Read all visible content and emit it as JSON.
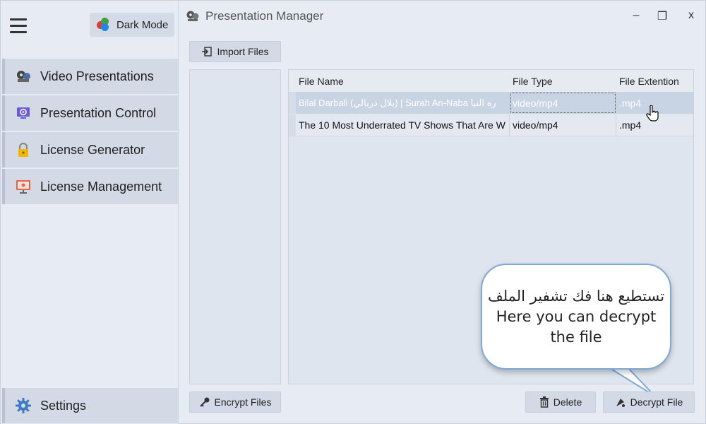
{
  "window": {
    "title": "Presentation Manager",
    "controls": {
      "minimize": "–",
      "maximize": "❐",
      "close": "x"
    }
  },
  "sidebar": {
    "dark_mode_label": "Dark Mode",
    "items": [
      {
        "label": "Video Presentations",
        "icon": "film-reel-icon"
      },
      {
        "label": "Presentation Control",
        "icon": "monitor-gear-icon"
      },
      {
        "label": "License Generator",
        "icon": "padlock-icon"
      },
      {
        "label": "License Management",
        "icon": "presentation-board-icon"
      }
    ],
    "settings_label": "Settings"
  },
  "toolbar": {
    "import_label": "Import Files",
    "encrypt_label": "Encrypt Files",
    "delete_label": "Delete",
    "decrypt_label": "Decrypt File"
  },
  "table": {
    "headers": [
      "File Name",
      "File Type",
      "File Extention"
    ],
    "rows": [
      {
        "name": "Bilal Darbali (بلال دربالي) | Surah An-Naba  ره النبا",
        "type": "video/mp4",
        "ext": ".mp4",
        "selected": true
      },
      {
        "name": "The 10 Most Underrated TV Shows That Are W",
        "type": "video/mp4",
        "ext": ".mp4",
        "selected": false
      }
    ]
  },
  "callout": {
    "line_ar": "تستطيع هنا فك تشفير الملف",
    "line_en1": "Here you can decrypt",
    "line_en2": "the file"
  },
  "colors": {
    "sidebar_item_bg": "#d3dae6",
    "selected_row_bg": "#c8d3e4",
    "callout_border": "#7fa9d8"
  }
}
